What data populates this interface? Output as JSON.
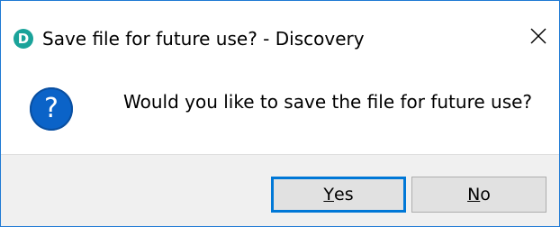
{
  "window": {
    "title": "Save file for future use? - Discovery",
    "app_icon_letter": "D",
    "app_icon_color": "#1aa39a",
    "close_icon": "close-icon"
  },
  "message": {
    "icon": "question-icon",
    "icon_glyph": "?",
    "icon_color": "#0b63c8",
    "text": "Would you like to save the file for future use?"
  },
  "buttons": {
    "yes": {
      "mnemonic": "Y",
      "rest": "es",
      "is_default": true
    },
    "no": {
      "mnemonic": "N",
      "rest": "o",
      "is_default": false
    }
  },
  "colors": {
    "focus_border": "#0078d7",
    "footer_bg": "#f0f0f0"
  }
}
